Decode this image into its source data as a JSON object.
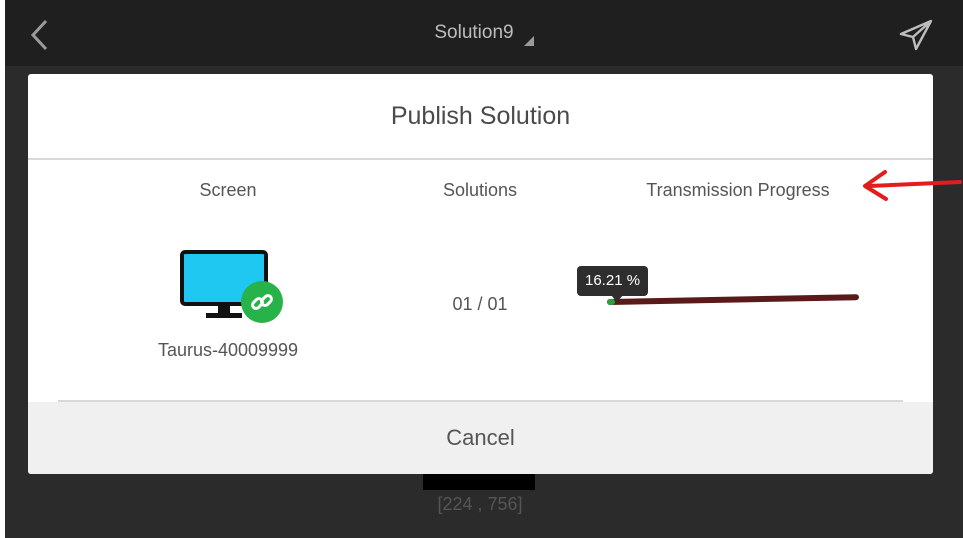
{
  "header": {
    "title": "Solution9",
    "back_icon": "chevron-left-icon",
    "send_icon": "send-icon"
  },
  "background": {
    "coords_text": "[224 , 756]"
  },
  "dialog": {
    "title": "Publish Solution",
    "columns": {
      "screen": "Screen",
      "solutions": "Solutions",
      "progress": "Transmission Progress"
    },
    "row": {
      "device_icon": "monitor-link-icon",
      "device_name": "Taurus-40009999",
      "solutions_count": "01 / 01",
      "progress_label": "16.21 %",
      "progress_fraction": 0.1621
    },
    "cancel_label": "Cancel"
  },
  "colors": {
    "progress_fill": "#2e9e3e",
    "progress_track": "#5a1a1a",
    "monitor_screen": "#1ec8f0",
    "link_badge": "#27b34a",
    "annotation_arrow": "#e41c1c"
  }
}
